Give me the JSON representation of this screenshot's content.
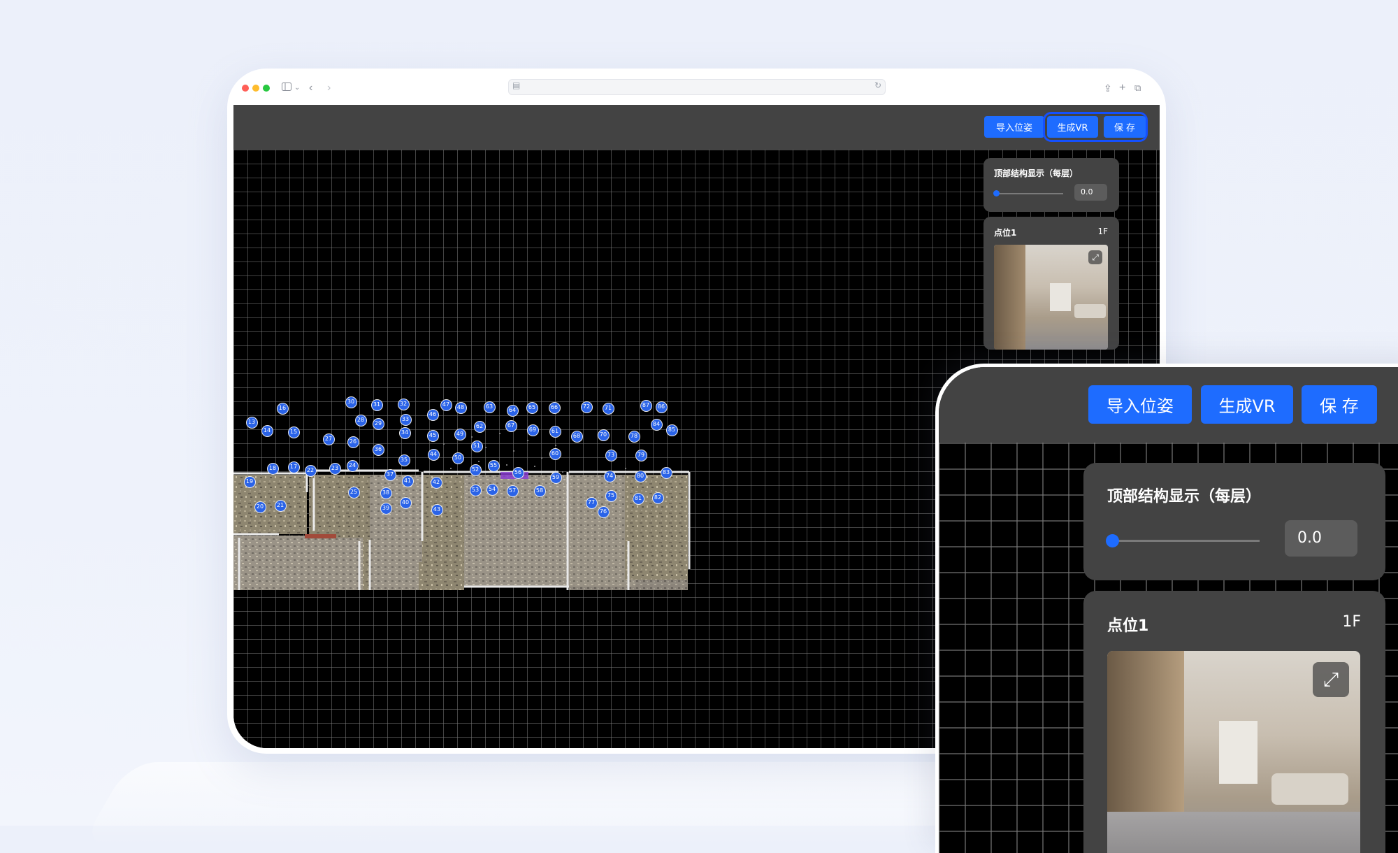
{
  "toolbar": {
    "import_pose_label": "导入位姿",
    "generate_vr_label": "生成VR",
    "save_label": "保 存"
  },
  "structure_panel": {
    "title": "顶部结构显示（每层）",
    "value": "0.0",
    "slider_fraction": 0.0
  },
  "point_panel": {
    "title": "点位1",
    "floor": "1F"
  },
  "markers": [
    "13",
    "14",
    "15",
    "16",
    "17",
    "18",
    "19",
    "20",
    "21",
    "22",
    "23",
    "24",
    "25",
    "26",
    "27",
    "28",
    "29",
    "30",
    "31",
    "32",
    "33",
    "34",
    "35",
    "36",
    "37",
    "38",
    "39",
    "40",
    "41",
    "42",
    "43",
    "44",
    "45",
    "46",
    "47",
    "48",
    "49",
    "50",
    "51",
    "52",
    "53",
    "54",
    "55",
    "56",
    "57",
    "58",
    "59",
    "60",
    "61",
    "62",
    "63",
    "64",
    "65",
    "66",
    "67",
    "68",
    "69",
    "70",
    "71",
    "72",
    "73",
    "74",
    "75",
    "76",
    "77",
    "78",
    "79",
    "80",
    "81",
    "82",
    "83",
    "84",
    "85",
    "86",
    "87"
  ],
  "colors": {
    "accent": "#1e6cff",
    "toolbar": "#434343",
    "canvas": "#000000",
    "marker": "#2a63e8"
  },
  "icons": [
    "sidebar-icon",
    "chevron-down-icon",
    "back-icon",
    "forward-icon",
    "page-icon",
    "reload-icon",
    "share-icon",
    "new-tab-icon",
    "tabs-icon",
    "expand-icon"
  ]
}
